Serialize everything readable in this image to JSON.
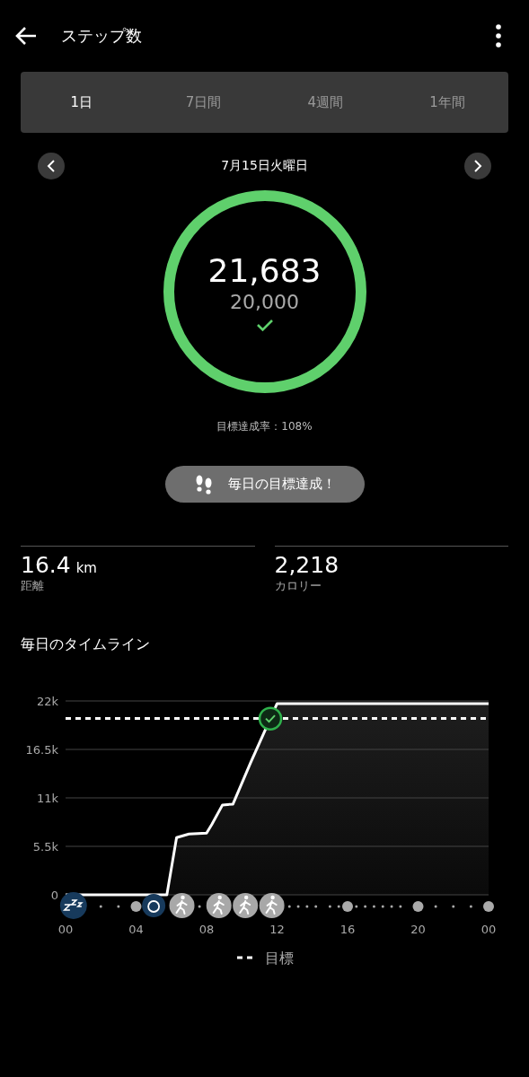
{
  "header": {
    "title": "ステップ数"
  },
  "tabs": [
    {
      "label": "1日",
      "selected": true
    },
    {
      "label": "7日間",
      "selected": false
    },
    {
      "label": "4週間",
      "selected": false
    },
    {
      "label": "1年間",
      "selected": false
    }
  ],
  "date": "7月15日火曜日",
  "ring": {
    "steps": "21,683",
    "goal": "20,000",
    "achieved": true
  },
  "goal_rate": "目標達成率：108%",
  "badge": "毎日の目標達成！",
  "stats": [
    {
      "value": "16.4",
      "unit": "km",
      "label": "距離"
    },
    {
      "value": "2,218",
      "label": "カロリー"
    }
  ],
  "timeline": {
    "title": "毎日のタイムライン",
    "chart_data": {
      "type": "line",
      "x": [
        0,
        4,
        5.75,
        6.3,
        7,
        8,
        8.3,
        8.9,
        9.5,
        10.5,
        11.4,
        12,
        24
      ],
      "series": [
        {
          "type": "area",
          "color": "#ffffff",
          "values": [
            0,
            0,
            0,
            6500,
            6900,
            7000,
            8000,
            10200,
            10300,
            15000,
            null,
            21700,
            21700
          ]
        },
        {
          "name": "目標",
          "color": "#ffffff",
          "line_style": "dashed",
          "values": [
            20000,
            20000,
            20000,
            20000,
            20000,
            20000,
            20000,
            20000,
            20000,
            20000,
            null,
            null,
            20000
          ]
        }
      ],
      "grid": true,
      "xlim": [
        0,
        24
      ],
      "ylim": [
        0,
        22000
      ],
      "xticks": [
        {
          "value": 0,
          "label": "00"
        },
        {
          "value": 4,
          "label": "04"
        },
        {
          "value": 8,
          "label": "08"
        },
        {
          "value": 12,
          "label": "12"
        },
        {
          "value": 16,
          "label": "16"
        },
        {
          "value": 20,
          "label": "20"
        },
        {
          "value": 24,
          "label": "00"
        }
      ],
      "yticks": [
        {
          "value": 0,
          "label": "0"
        },
        {
          "value": 5500,
          "label": "5.5k"
        },
        {
          "value": 11000,
          "label": "11k"
        },
        {
          "value": 16500,
          "label": "16.5k"
        },
        {
          "value": 22000,
          "label": "22k"
        }
      ]
    }
  }
}
